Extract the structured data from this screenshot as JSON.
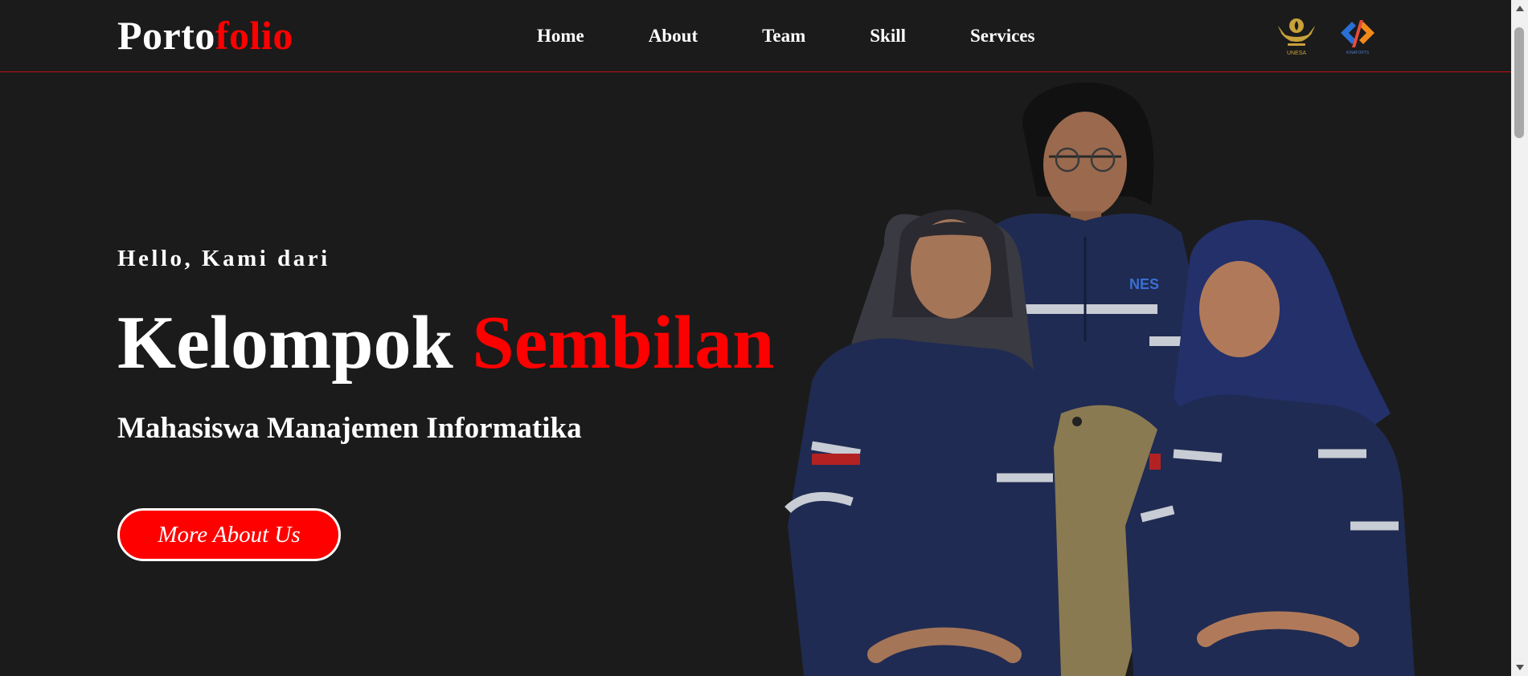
{
  "header": {
    "logo_primary": "Porto",
    "logo_accent": "folio",
    "nav": [
      {
        "label": "Home"
      },
      {
        "label": "About"
      },
      {
        "label": "Team"
      },
      {
        "label": "Skill"
      },
      {
        "label": "Services"
      }
    ],
    "partner_logos": [
      {
        "icon": "unesa-emblem-icon",
        "caption": "UNESA"
      },
      {
        "icon": "code-brackets-logo-icon",
        "caption": "KINAFORTS"
      }
    ]
  },
  "hero": {
    "greeting": "Hello, Kami dari",
    "title_primary": "Kelompok",
    "title_accent": "Sembilan",
    "subtitle": "Mahasiswa Manajemen Informatika",
    "cta_label": "More About Us"
  },
  "colors": {
    "background": "#1b1b1b",
    "accent": "#ff0000",
    "text": "#ffffff",
    "uniform": "#1f2b52",
    "divider": "#c40f12"
  }
}
